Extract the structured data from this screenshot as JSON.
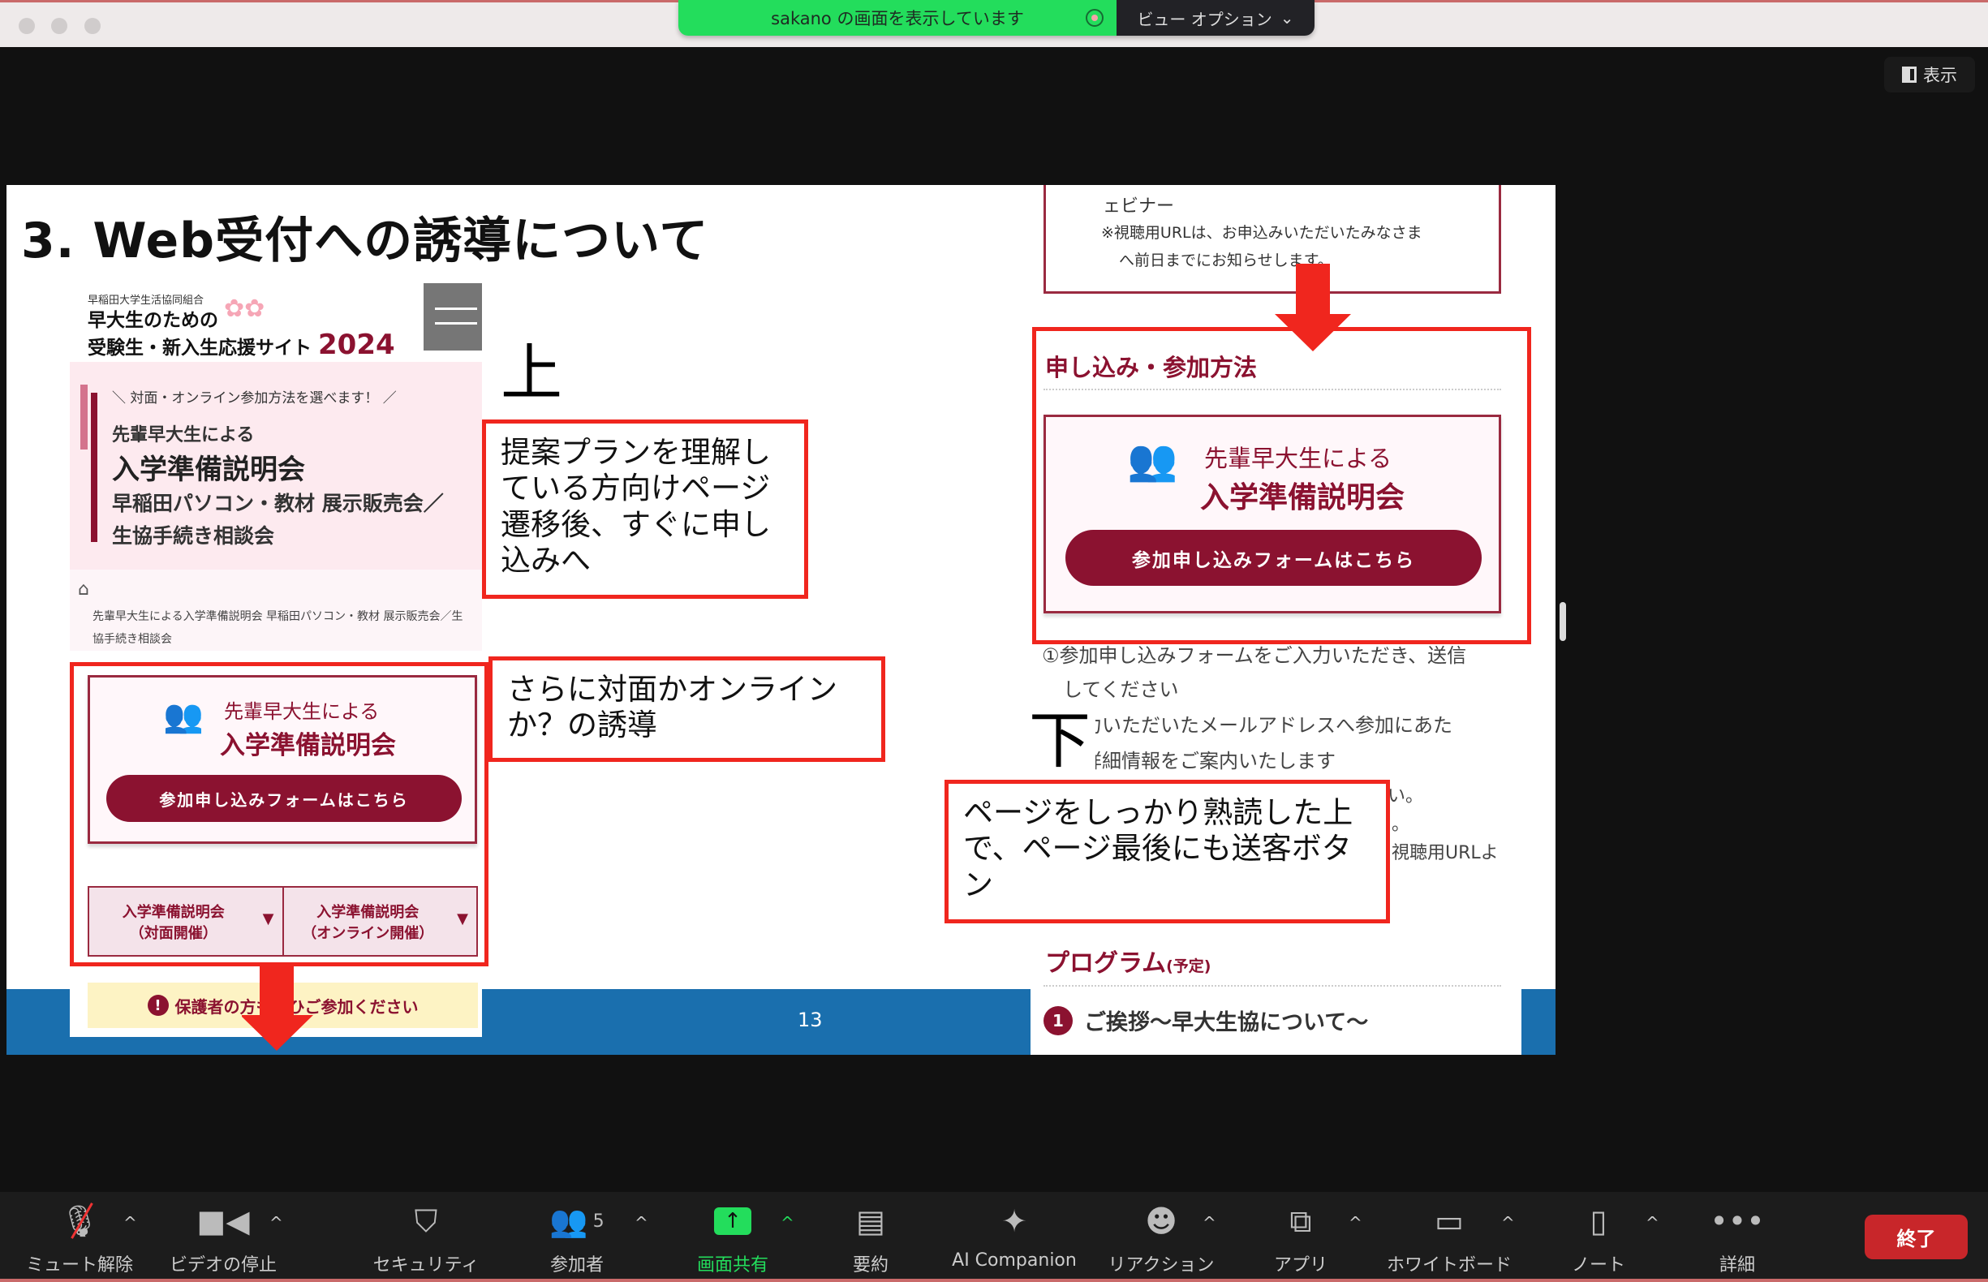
{
  "window": {
    "banner_text": "sakano の画面を表示しています",
    "view_options": "ビュー オプション",
    "view_button": "表示"
  },
  "slide": {
    "title": "3. Web受付への誘導について",
    "page_number": "13",
    "label_top": "上",
    "label_bottom": "下",
    "callouts": [
      "提案プランを理解している方向けページ遷移後、すぐに申し込みへ",
      "さらに対面かオンラインか？の誘導",
      "ページをしっかり熟読した上で、ページ最後にも送客ボタン"
    ],
    "left_page": {
      "org": "早稲田大学生活協同組合",
      "site_line1": "早大生のための",
      "site_line2": "受験生・新入生応援サイト",
      "year": "2024",
      "hero_tag": "＼ 対面・オンライン参加方法を選べます！ ／",
      "hero_sub": "先輩早大生による",
      "hero_title": "入学準備説明会",
      "hero_line3": "早稲田パソコン・教材 展示販売会／",
      "hero_line4": "生協手続き相談会",
      "breadcrumb": "先輩早大生による入学準備説明会 早稲田パソコン・教材 展示販売会／生協手続き相談会",
      "card_sub": "先輩早大生による",
      "card_title": "入学準備説明会",
      "form_button": "参加申し込みフォームはこちら",
      "tabs": [
        {
          "line1": "入学準備説明会",
          "line2": "（対面開催）"
        },
        {
          "line1": "入学準備説明会",
          "line2": "（オンライン開催）"
        }
      ],
      "notice": "保護者の方もぜひご参加ください"
    },
    "right_page": {
      "top_box_line1": "ェビナー",
      "top_box_line2": "※視聴用URLは、お申込みいただいたみなさま",
      "top_box_line3": "へ前日までにお知らせします。",
      "section_title": "申し込み・参加方法",
      "card_sub": "先輩早大生による",
      "card_title": "入学準備説明会",
      "form_button": "参加申し込みフォームはこちら",
      "steps": [
        "①参加申し込みフォームをご入力いただき、送信",
        "してください",
        "入力いただいたメールアドレスへ参加にあた",
        "の詳細情報をご案内いたします",
        "い。",
        "。",
        "視聴用URLよ"
      ],
      "program_title": "プログラム",
      "program_note": "(予定)",
      "program_item_num": "1",
      "program_item": "ご挨拶〜早大生協について〜"
    }
  },
  "toolbar": {
    "items": [
      {
        "label": "ミュート解除",
        "icon": "microphone-muted-icon"
      },
      {
        "label": "ビデオの停止",
        "icon": "video-camera-icon"
      },
      {
        "label": "セキュリティ",
        "icon": "shield-icon"
      },
      {
        "label": "参加者",
        "icon": "participants-icon",
        "count": "5"
      },
      {
        "label": "画面共有",
        "icon": "share-screen-icon"
      },
      {
        "label": "要約",
        "icon": "summary-icon"
      },
      {
        "label": "AI Companion",
        "icon": "sparkle-icon"
      },
      {
        "label": "リアクション",
        "icon": "emoji-icon"
      },
      {
        "label": "アプリ",
        "icon": "apps-icon"
      },
      {
        "label": "ホワイトボード",
        "icon": "whiteboard-icon"
      },
      {
        "label": "ノート",
        "icon": "notes-icon"
      },
      {
        "label": "詳細",
        "icon": "more-icon"
      }
    ],
    "end_button": "終了",
    "colors": {
      "share_active": "#23dd5c",
      "end": "#c8262a"
    }
  },
  "colors": {
    "annotation_red": "#f0261e",
    "brand_wine": "#8b1230",
    "slide_band": "#1a6fae"
  }
}
